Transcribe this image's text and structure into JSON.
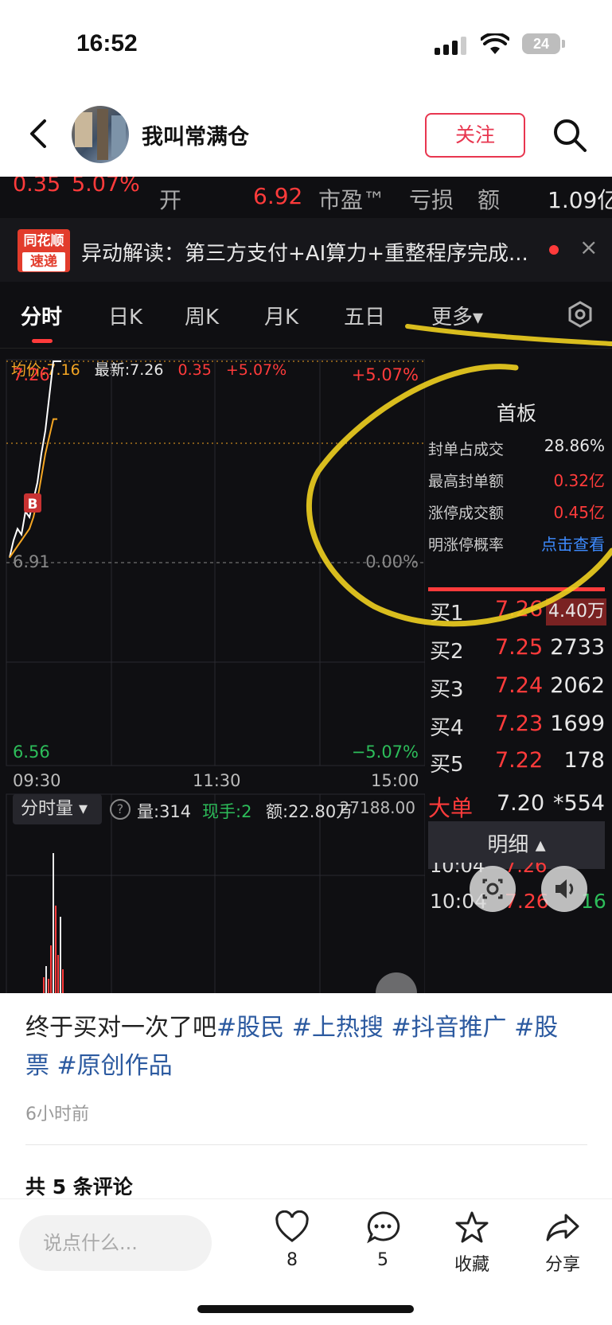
{
  "status_bar": {
    "time": "16:52",
    "battery": "24"
  },
  "header": {
    "username": "我叫常满仓",
    "follow_label": "关注"
  },
  "quote_row": {
    "change": "0.35",
    "change_pct": "5.07%",
    "open_label": "开",
    "open_value": "6.92",
    "pe_label": "市盈™",
    "pe_value": "亏损",
    "amount_label": "额",
    "amount_value": "1.09亿"
  },
  "banner": {
    "logo_line1": "同花顺",
    "logo_line2": "速递",
    "text": "异动解读：第三方支付+AI算力+重整程序完成...",
    "close": "×"
  },
  "tabs": [
    "分时",
    "日K",
    "周K",
    "月K",
    "五日",
    "更多▾"
  ],
  "chart_header": {
    "avg": "均价:7.16",
    "latest": "最新:7.26",
    "change": "0.35",
    "change_pct": "+5.07%"
  },
  "chart_data": {
    "type": "line",
    "title": "",
    "y_labels": {
      "top": "7.26",
      "mid": "6.91",
      "bottom": "6.56"
    },
    "pct_labels": {
      "top": "+5.07%",
      "mid": "0.00%",
      "bottom": "−5.07%"
    },
    "x_labels": [
      "09:30",
      "11:30",
      "15:00"
    ],
    "ylim": [
      6.56,
      7.26
    ],
    "series": [
      {
        "values": [
          6.92,
          6.95,
          6.97,
          6.96,
          7.0,
          6.99,
          7.02,
          7.05,
          7.1,
          7.14,
          7.2,
          7.26,
          7.26,
          7.26
        ],
        "color": "#ffffff"
      },
      {
        "values": [
          6.92,
          6.93,
          6.94,
          6.95,
          6.96,
          6.97,
          6.99,
          7.02,
          7.06,
          7.1,
          7.13,
          7.16,
          7.16
        ],
        "color": "#f5a623"
      }
    ],
    "marker": "B"
  },
  "board": {
    "title": "首板",
    "stats": [
      {
        "label": "封单占成交",
        "value": "28.86%",
        "color": "#e8e8e8"
      },
      {
        "label": "最高封单额",
        "value": "0.32亿",
        "color": "#ff3b3b"
      },
      {
        "label": "涨停成交额",
        "value": "0.45亿",
        "color": "#ff3b3b"
      },
      {
        "label": "明涨停概率",
        "value": "点击查看",
        "color": "#3d8bff"
      }
    ]
  },
  "order_book": [
    {
      "label": "买1",
      "price": "7.26",
      "vol": "4.40万"
    },
    {
      "label": "买2",
      "price": "7.25",
      "vol": "2733"
    },
    {
      "label": "买3",
      "price": "7.24",
      "vol": "2062"
    },
    {
      "label": "买4",
      "price": "7.23",
      "vol": "1699"
    },
    {
      "label": "买5",
      "price": "7.22",
      "vol": "178"
    }
  ],
  "big_order": {
    "label": "大单",
    "price": "7.20",
    "vol": "*554"
  },
  "detail": {
    "label": "明细 ▴",
    "row1_time": "10:04",
    "row1_price": "7.26",
    "row2_time": "10:04",
    "row2_price": "7.26",
    "row2_vol": "16"
  },
  "volume": {
    "chip": "分时量 ▾",
    "qty": "量:314",
    "current": "现手:2",
    "amount": "额:22.80万",
    "max": "27188.00"
  },
  "caption": {
    "text": "终于买对一次了吧",
    "tags": [
      "#股民",
      "#上热搜",
      "#抖音推广",
      "#股",
      "票",
      "#原创作品"
    ]
  },
  "time_ago": "6小时前",
  "comments_count": "共 5 条评论",
  "bottom": {
    "placeholder": "说点什么...",
    "likes": "8",
    "comments": "5",
    "fav_label": "收藏",
    "share_label": "分享"
  }
}
